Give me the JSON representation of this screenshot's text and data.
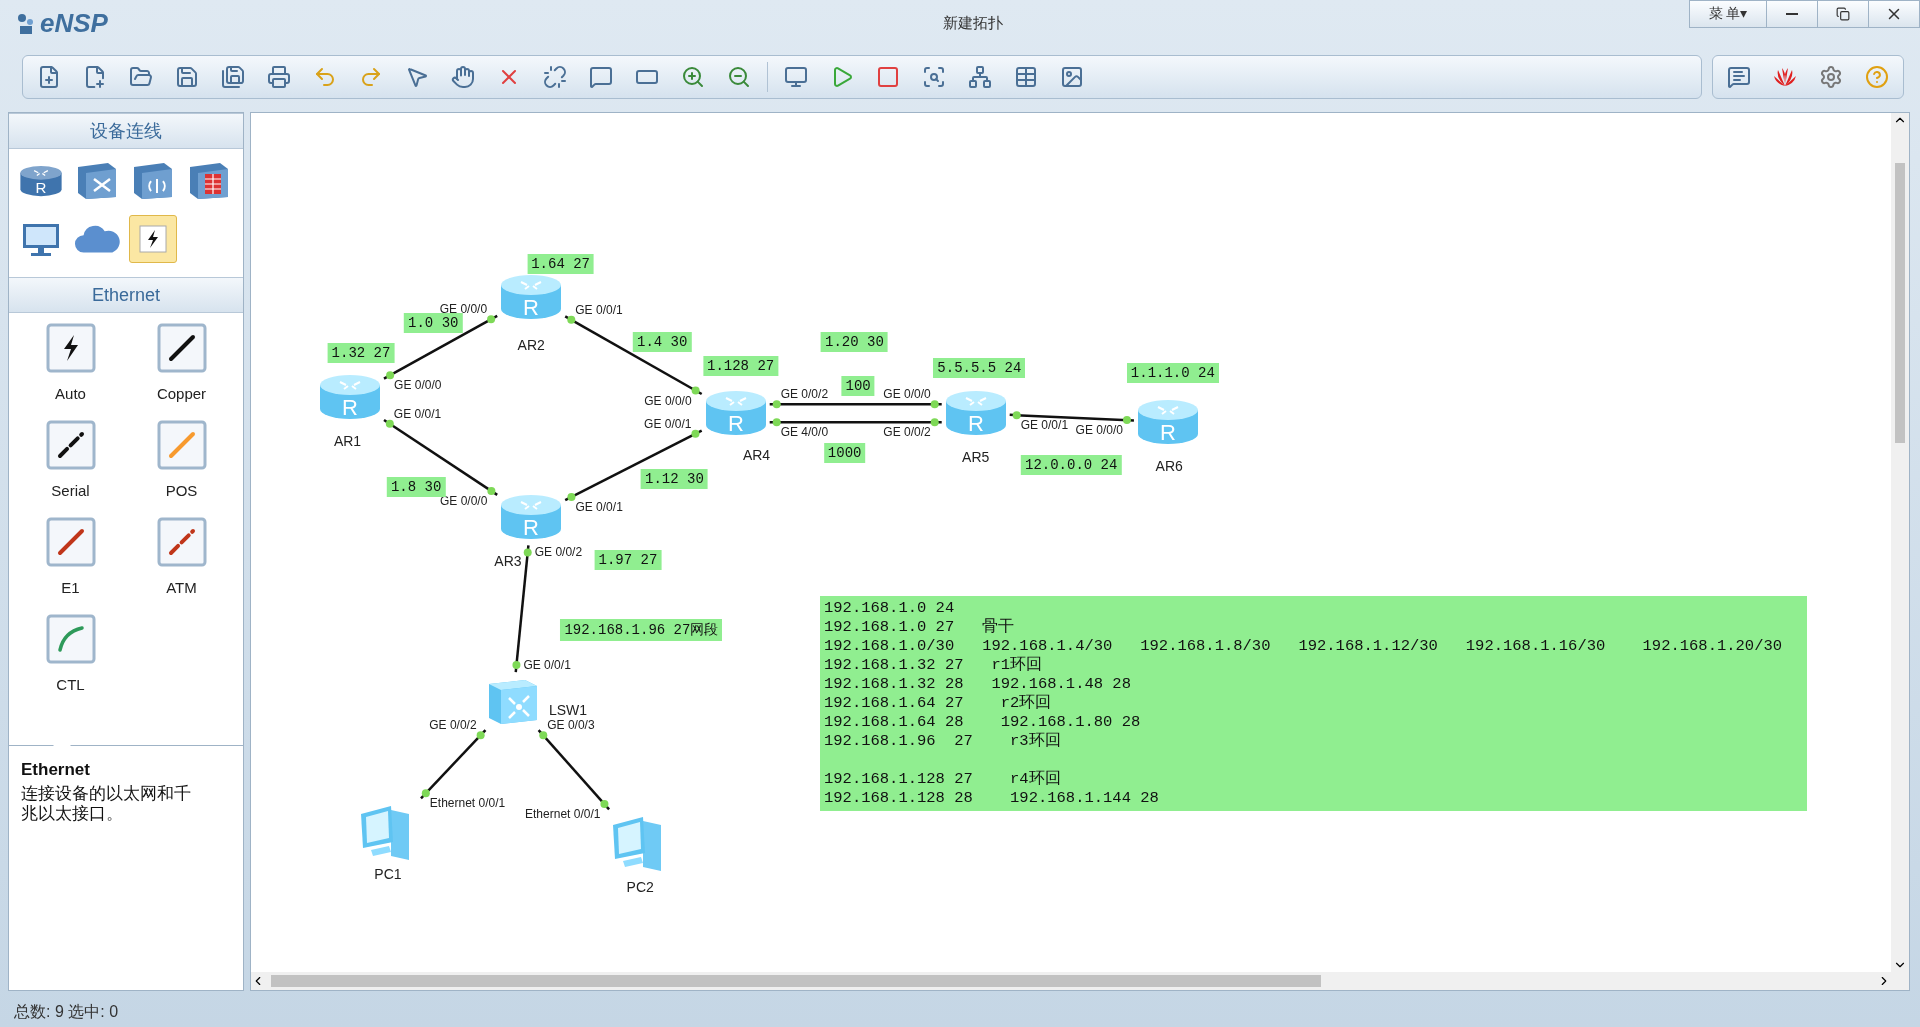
{
  "app": {
    "logo": "eNSP",
    "title": "新建拓扑",
    "menu": "菜 单▾"
  },
  "palette": {
    "title": "设备连线",
    "categories": [
      {
        "kind": "router",
        "glyph": "R",
        "selected": false
      },
      {
        "kind": "switch",
        "selected": false
      },
      {
        "kind": "wireless",
        "selected": false
      },
      {
        "kind": "firewall",
        "selected": false
      },
      {
        "kind": "pc",
        "selected": false
      },
      {
        "kind": "cloud",
        "selected": false
      },
      {
        "kind": "link",
        "selected": true
      }
    ]
  },
  "cables": {
    "title": "Ethernet",
    "items": [
      {
        "label": "Auto",
        "kind": "auto"
      },
      {
        "label": "Copper",
        "kind": "copper"
      },
      {
        "label": "Serial",
        "kind": "serial"
      },
      {
        "label": "POS",
        "kind": "pos"
      },
      {
        "label": "E1",
        "kind": "e1"
      },
      {
        "label": "ATM",
        "kind": "atm"
      },
      {
        "label": "CTL",
        "kind": "ctl"
      }
    ]
  },
  "description": {
    "title": "Ethernet",
    "text": "连接设备的以太网和千兆以太接口。"
  },
  "topology": {
    "devices": [
      {
        "kind": "router",
        "glyph": "R",
        "name": "AR1"
      },
      {
        "kind": "router",
        "glyph": "R",
        "name": "AR2"
      },
      {
        "kind": "router",
        "glyph": "R",
        "name": "AR3"
      },
      {
        "kind": "router",
        "glyph": "R",
        "name": "AR4"
      },
      {
        "kind": "router",
        "glyph": "R",
        "name": "AR5"
      },
      {
        "kind": "router",
        "glyph": "R",
        "name": "AR6"
      },
      {
        "kind": "switch",
        "name": "LSW1"
      },
      {
        "kind": "pc",
        "name": "PC1"
      },
      {
        "kind": "pc",
        "name": "PC2"
      }
    ],
    "links": [
      {
        "ports": [
          "GE 0/0/0",
          "GE 0/0/0"
        ]
      },
      {
        "ports": [
          "GE 0/0/1",
          "GE 0/0/0"
        ]
      },
      {
        "ports": [
          "GE 0/0/1",
          "GE 0/0/0"
        ]
      },
      {
        "ports": [
          "GE 0/0/1",
          "GE 0/0/1"
        ]
      },
      {
        "ports": [
          "GE 0/0/2",
          "GE 0/0/0"
        ]
      },
      {
        "ports": [
          "GE 4/0/0",
          "GE 0/0/2"
        ]
      },
      {
        "ports": [
          "GE 0/0/1",
          "GE 0/0/0"
        ]
      },
      {
        "ports": [
          "GE 0/0/2",
          "GE 0/0/1"
        ]
      },
      {
        "ports": [
          "GE 0/0/2",
          "Ethernet 0/0/1"
        ]
      },
      {
        "ports": [
          "GE 0/0/3",
          "Ethernet 0/0/1"
        ]
      }
    ],
    "labels": [
      "1.64 27",
      "1.0 30",
      "1.32 27",
      "1.4 30",
      "1.128 27",
      "1.20 30",
      "100",
      "5.5.5.5 24",
      "1.1.1.0 24",
      "1000",
      "12.0.0.0 24",
      "1.8 30",
      "1.12 30",
      "1.97 27",
      "192.168.1.96 27网段"
    ],
    "memo": {
      "blocks": [
        [
          "192.168.1.0 24",
          "192.168.1.0 27   骨干",
          "192.168.1.0/30   192.168.1.4/30   192.168.1.8/30   192.168.1.12/30   192.168.1.16/30    192.168.1.20/30",
          "192.168.1.32 27   r1环回",
          "192.168.1.32 28   192.168.1.48 28",
          "192.168.1.64 27    r2环回",
          "192.168.1.64 28    192.168.1.80 28",
          "192.168.1.96  27    r3环回"
        ],
        [
          "192.168.1.128 27    r4环回",
          "192.168.1.128 28    192.168.1.144 28"
        ]
      ]
    }
  },
  "status_bar": {
    "text": "总数: 9  选中: 0"
  }
}
